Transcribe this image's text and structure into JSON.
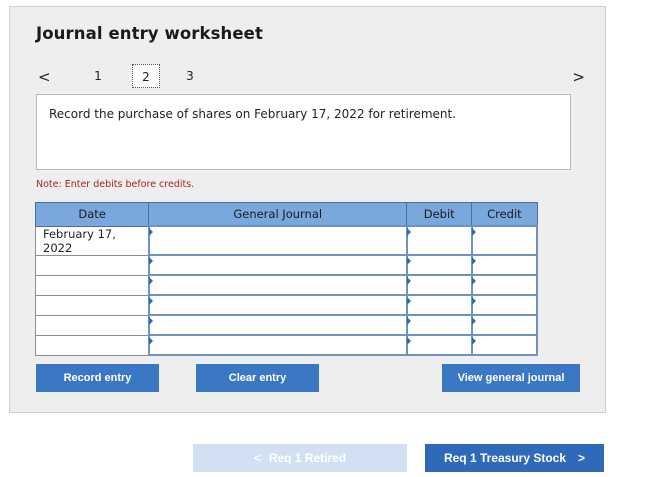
{
  "worksheet": {
    "title": "Journal entry worksheet",
    "pager": {
      "prev_glyph": "<",
      "next_glyph": ">",
      "pages": [
        "1",
        "2",
        "3"
      ],
      "active_page": "2"
    },
    "instruction": "Record the purchase of shares on February 17, 2022 for retirement.",
    "note": "Note: Enter debits before credits.",
    "table": {
      "headers": [
        "Date",
        "General Journal",
        "Debit",
        "Credit"
      ],
      "rows": [
        {
          "date": "February 17, 2022",
          "account": "",
          "debit": "",
          "credit": ""
        },
        {
          "date": "",
          "account": "",
          "debit": "",
          "credit": ""
        },
        {
          "date": "",
          "account": "",
          "debit": "",
          "credit": ""
        },
        {
          "date": "",
          "account": "",
          "debit": "",
          "credit": ""
        },
        {
          "date": "",
          "account": "",
          "debit": "",
          "credit": ""
        },
        {
          "date": "",
          "account": "",
          "debit": "",
          "credit": ""
        }
      ]
    },
    "buttons": {
      "record": "Record entry",
      "clear": "Clear entry",
      "view": "View general journal"
    }
  },
  "navigation": {
    "prev_label": "Req 1 Retired",
    "prev_glyph": "<",
    "next_label": "Req 1 Treasury Stock",
    "next_glyph": ">"
  },
  "colors": {
    "header_blue": "#7aa7dc",
    "button_blue": "#3b78c4",
    "note_red": "#a3261d",
    "disabled_blue": "#d1e0f3"
  }
}
